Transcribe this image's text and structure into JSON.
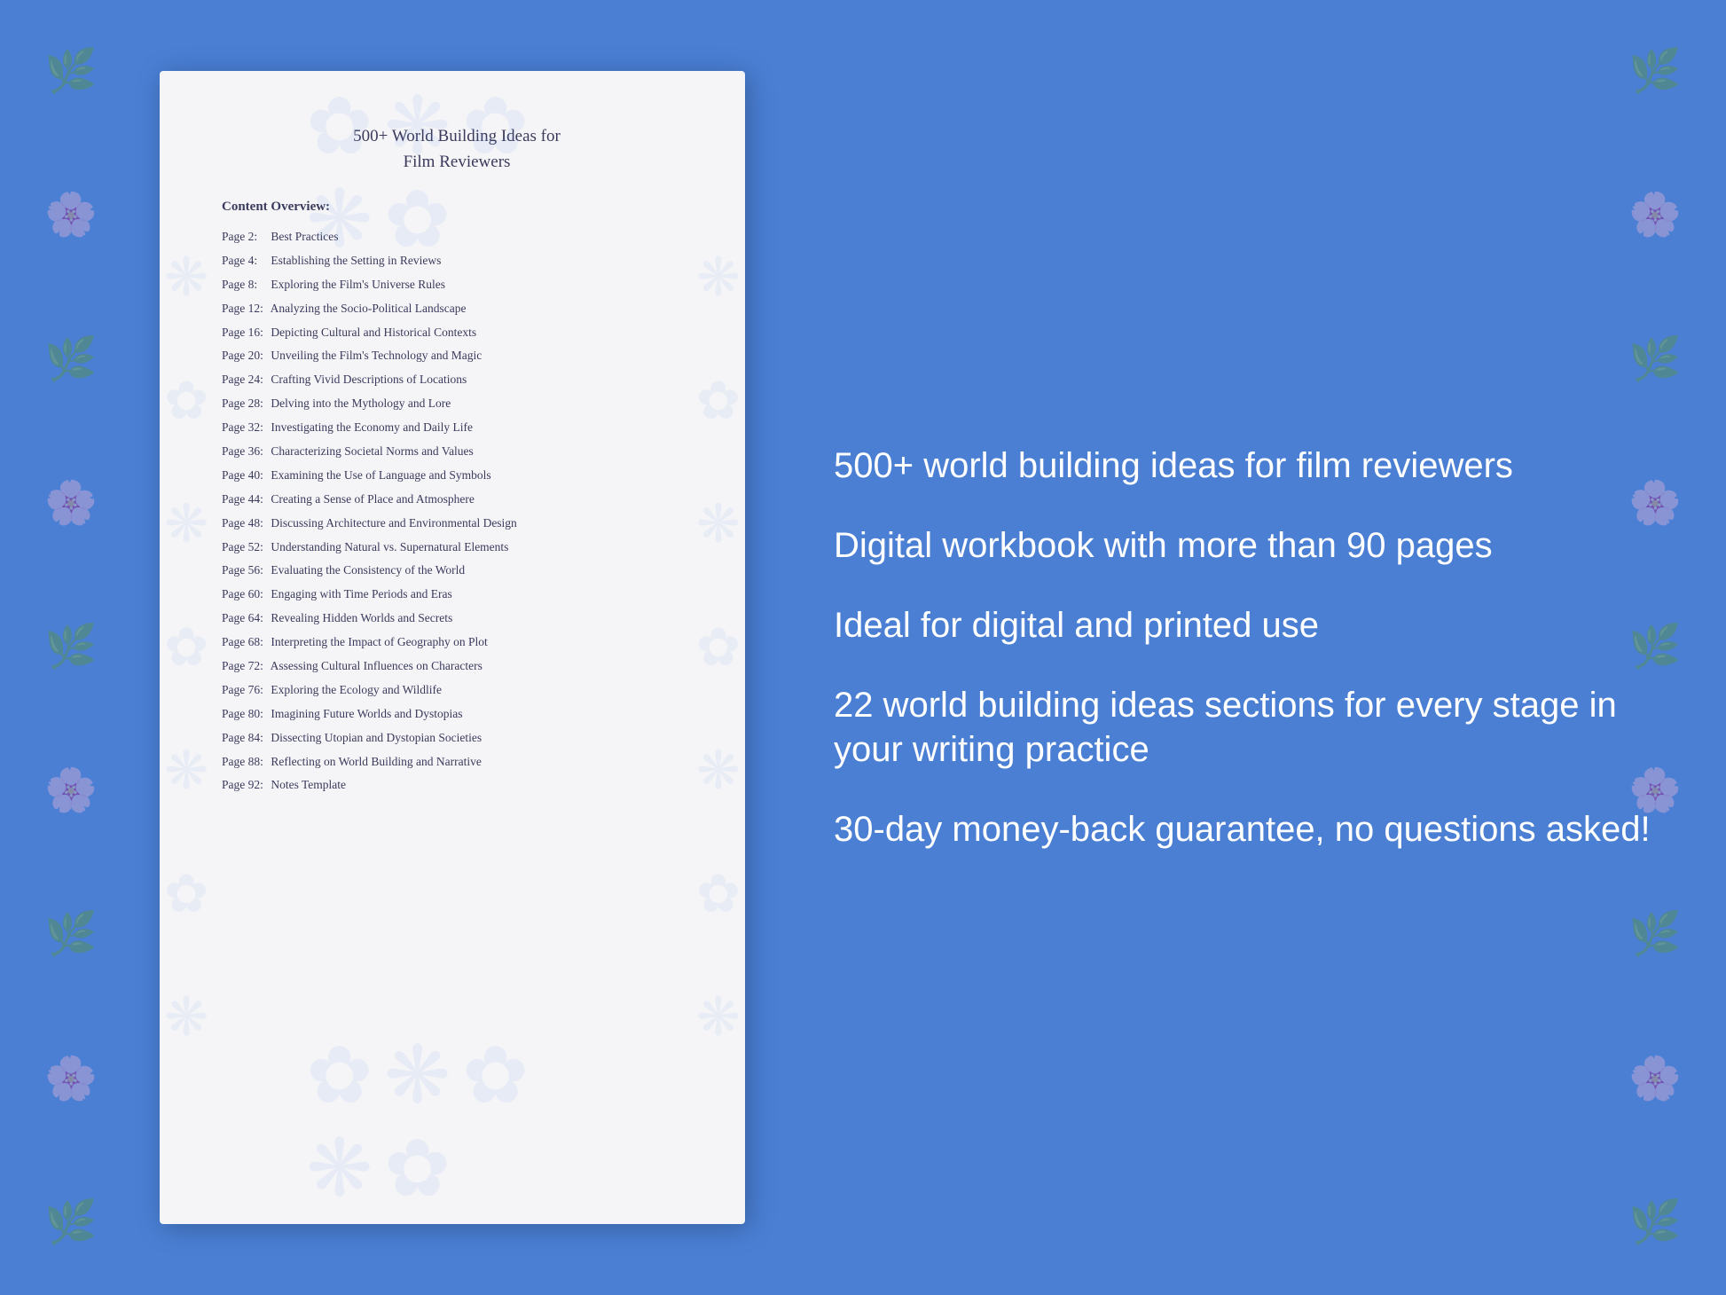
{
  "document": {
    "title_line1": "500+ World Building Ideas for",
    "title_line2": "Film Reviewers",
    "section_label": "Content Overview:",
    "toc_items": [
      {
        "page": "Page  2:",
        "title": "Best Practices"
      },
      {
        "page": "Page  4:",
        "title": "Establishing the Setting in Reviews"
      },
      {
        "page": "Page  8:",
        "title": "Exploring the Film's Universe Rules"
      },
      {
        "page": "Page 12:",
        "title": "Analyzing the Socio-Political Landscape"
      },
      {
        "page": "Page 16:",
        "title": "Depicting Cultural and Historical Contexts"
      },
      {
        "page": "Page 20:",
        "title": "Unveiling the Film's Technology and Magic"
      },
      {
        "page": "Page 24:",
        "title": "Crafting Vivid Descriptions of Locations"
      },
      {
        "page": "Page 28:",
        "title": "Delving into the Mythology and Lore"
      },
      {
        "page": "Page 32:",
        "title": "Investigating the Economy and Daily Life"
      },
      {
        "page": "Page 36:",
        "title": "Characterizing Societal Norms and Values"
      },
      {
        "page": "Page 40:",
        "title": "Examining the Use of Language and Symbols"
      },
      {
        "page": "Page 44:",
        "title": "Creating a Sense of Place and Atmosphere"
      },
      {
        "page": "Page 48:",
        "title": "Discussing Architecture and Environmental Design"
      },
      {
        "page": "Page 52:",
        "title": "Understanding Natural vs. Supernatural Elements"
      },
      {
        "page": "Page 56:",
        "title": "Evaluating the Consistency of the World"
      },
      {
        "page": "Page 60:",
        "title": "Engaging with Time Periods and Eras"
      },
      {
        "page": "Page 64:",
        "title": "Revealing Hidden Worlds and Secrets"
      },
      {
        "page": "Page 68:",
        "title": "Interpreting the Impact of Geography on Plot"
      },
      {
        "page": "Page 72:",
        "title": "Assessing Cultural Influences on Characters"
      },
      {
        "page": "Page 76:",
        "title": "Exploring the Ecology and Wildlife"
      },
      {
        "page": "Page 80:",
        "title": "Imagining Future Worlds and Dystopias"
      },
      {
        "page": "Page 84:",
        "title": "Dissecting Utopian and Dystopian Societies"
      },
      {
        "page": "Page 88:",
        "title": "Reflecting on World Building and Narrative"
      },
      {
        "page": "Page 92:",
        "title": "Notes Template"
      }
    ]
  },
  "info_panel": {
    "blocks": [
      "500+ world building ideas for film reviewers",
      "Digital workbook with more than 90 pages",
      "Ideal for digital and printed use",
      "22 world building ideas sections for every stage in your writing practice",
      "30-day money-back guarantee, no questions asked!"
    ]
  },
  "floral_symbol": "❧",
  "watermark_symbol": "❋"
}
